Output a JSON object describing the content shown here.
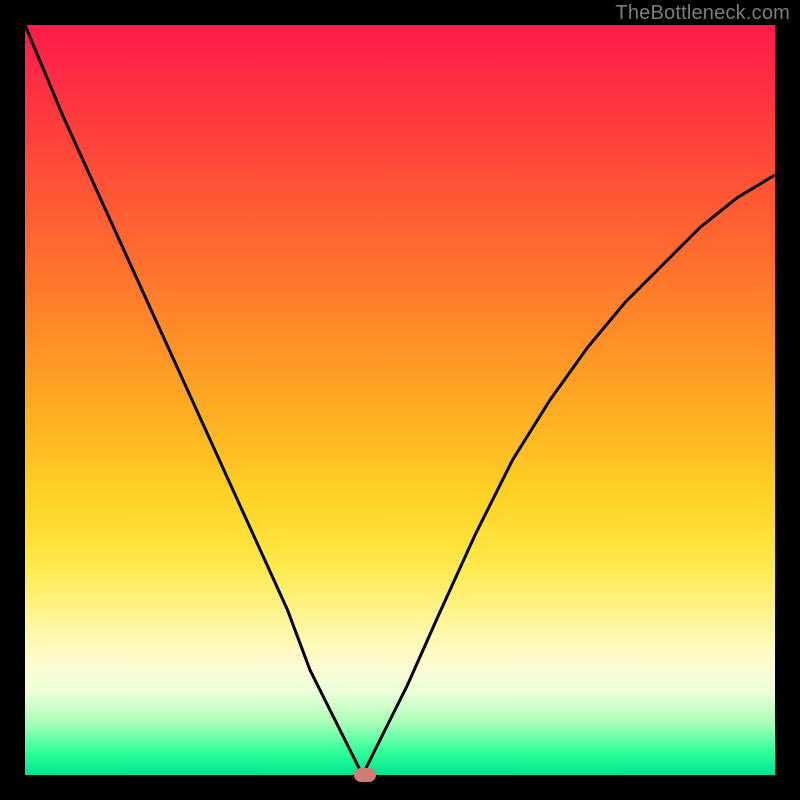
{
  "watermark": "TheBottleneck.com",
  "colors": {
    "frame": "#000000",
    "gradient": [
      "#ff1a4b",
      "#ff6a2f",
      "#ffd324",
      "#fffbd0",
      "#00e292"
    ],
    "curve": "#000000",
    "marker": "#cf7c71"
  },
  "chart_data": {
    "type": "line",
    "title": "",
    "xlabel": "",
    "ylabel": "",
    "xlim": [
      0,
      100
    ],
    "ylim": [
      0,
      100
    ],
    "grid": false,
    "legend": false,
    "series": [
      {
        "name": "bottleneck-curve",
        "x": [
          0,
          5,
          10,
          15,
          20,
          25,
          30,
          35,
          38,
          41,
          43,
          44,
          45,
          46,
          48,
          51,
          55,
          60,
          65,
          70,
          75,
          80,
          85,
          90,
          95,
          100
        ],
        "values": [
          100,
          88,
          77,
          66,
          55,
          44,
          33,
          22,
          14,
          8,
          4,
          2,
          0,
          2,
          6,
          12,
          21,
          32,
          42,
          50,
          57,
          63,
          68,
          73,
          77,
          80
        ]
      }
    ],
    "marker": {
      "x": 45.3,
      "y": 0,
      "label": ""
    }
  }
}
